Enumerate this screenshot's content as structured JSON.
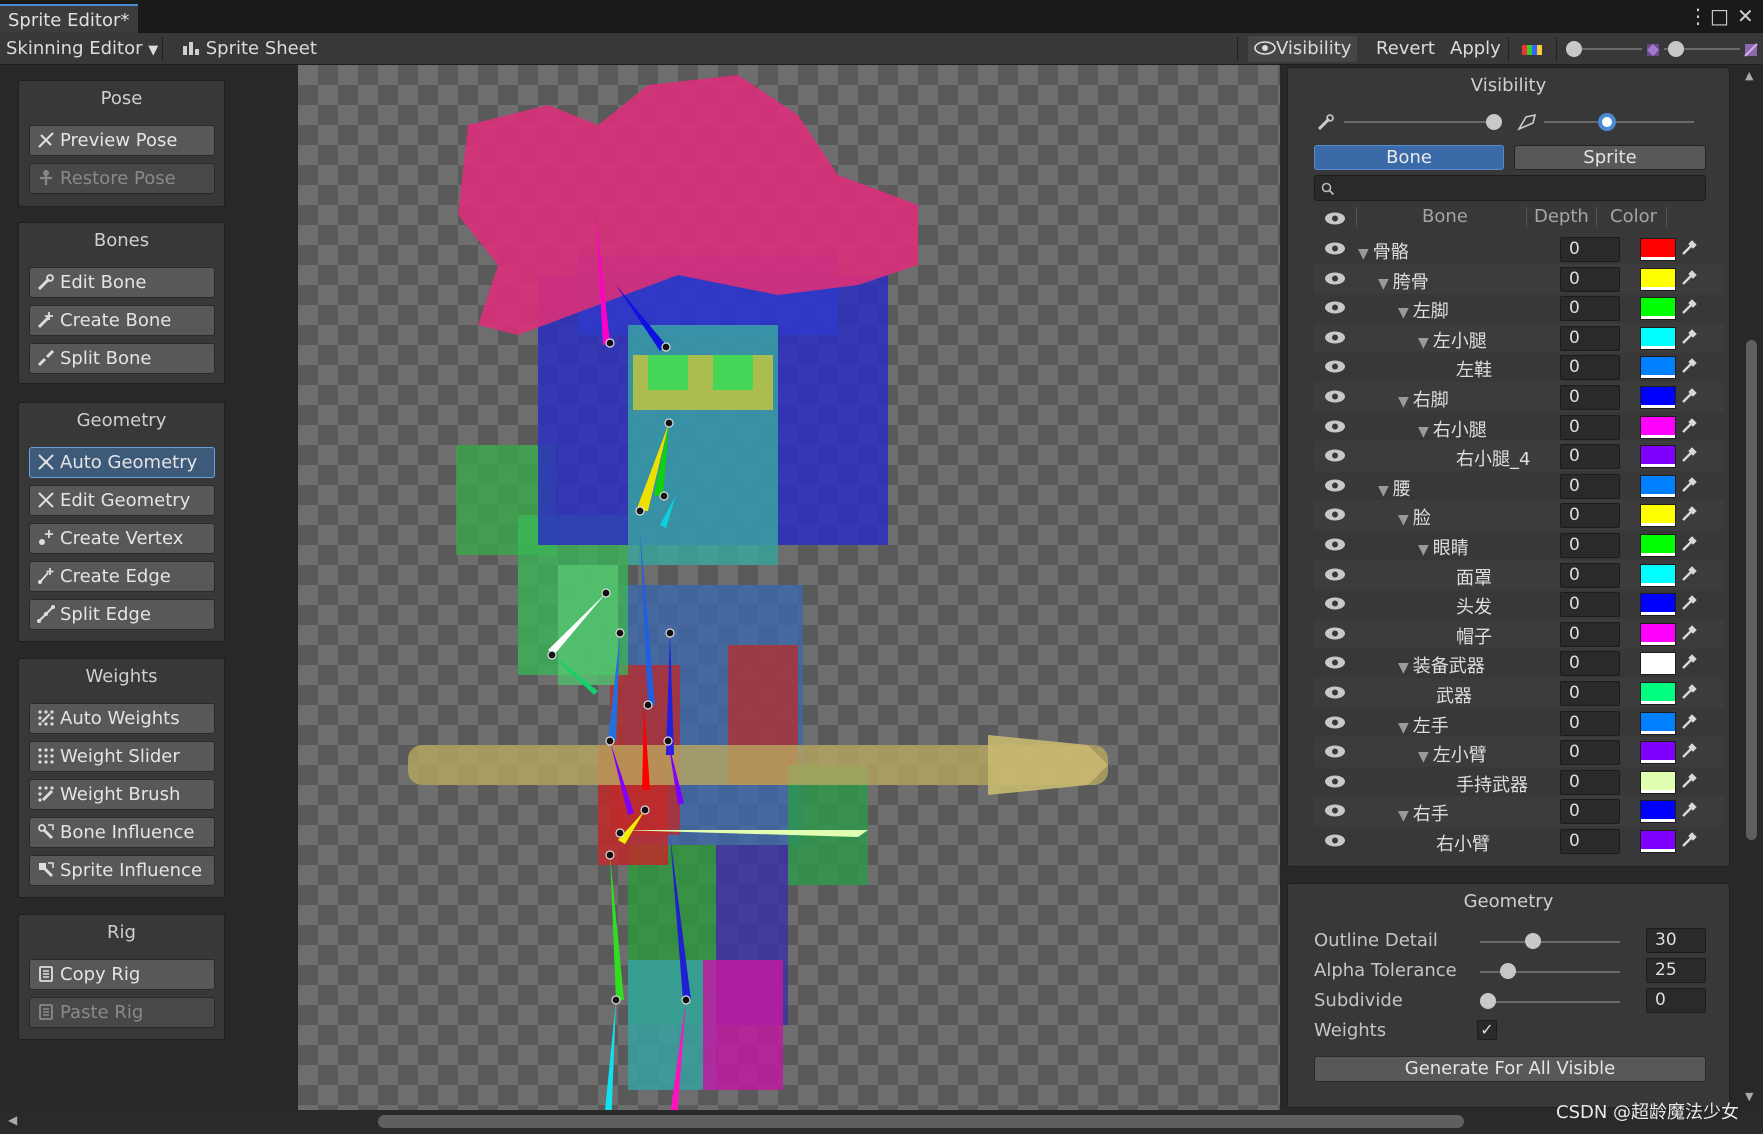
{
  "window": {
    "title": "Sprite Editor*"
  },
  "toolbar": {
    "editor_mode": "Skinning Editor",
    "sprite_sheet": "Sprite Sheet",
    "visibility": "Visibility",
    "revert": "Revert",
    "apply": "Apply"
  },
  "tools": {
    "pose": {
      "title": "Pose",
      "preview_pose": "Preview Pose",
      "restore_pose": "Restore Pose"
    },
    "bones": {
      "title": "Bones",
      "edit_bone": "Edit Bone",
      "create_bone": "Create Bone",
      "split_bone": "Split Bone"
    },
    "geometry": {
      "title": "Geometry",
      "auto_geometry": "Auto Geometry",
      "edit_geometry": "Edit Geometry",
      "create_vertex": "Create Vertex",
      "create_edge": "Create Edge",
      "split_edge": "Split Edge"
    },
    "weights": {
      "title": "Weights",
      "auto_weights": "Auto Weights",
      "weight_slider": "Weight Slider",
      "weight_brush": "Weight Brush",
      "bone_influence": "Bone Influence",
      "sprite_influence": "Sprite Influence"
    },
    "rig": {
      "title": "Rig",
      "copy_rig": "Copy Rig",
      "paste_rig": "Paste Rig"
    }
  },
  "visibility_panel": {
    "title": "Visibility",
    "bone_tab": "Bone",
    "sprite_tab": "Sprite",
    "search_placeholder": "",
    "columns": {
      "bone": "Bone",
      "depth": "Depth",
      "color": "Color"
    },
    "bone_opacity": 1.0,
    "sprite_opacity": 0.42,
    "bones": [
      {
        "name": "骨骼",
        "indent": 0,
        "arrow": true,
        "depth": "0",
        "color": "#ff0000"
      },
      {
        "name": "胯骨",
        "indent": 1,
        "arrow": true,
        "depth": "0",
        "color": "#ffff00"
      },
      {
        "name": "左脚",
        "indent": 2,
        "arrow": true,
        "depth": "0",
        "color": "#00ff00"
      },
      {
        "name": "左小腿",
        "indent": 3,
        "arrow": true,
        "depth": "0",
        "color": "#00ffff"
      },
      {
        "name": "左鞋",
        "indent": 4,
        "arrow": false,
        "depth": "0",
        "color": "#0080ff"
      },
      {
        "name": "右脚",
        "indent": 2,
        "arrow": true,
        "depth": "0",
        "color": "#0000ff"
      },
      {
        "name": "右小腿",
        "indent": 3,
        "arrow": true,
        "depth": "0",
        "color": "#ff00ff"
      },
      {
        "name": "右小腿_4",
        "indent": 4,
        "arrow": false,
        "depth": "0",
        "color": "#8000ff"
      },
      {
        "name": "腰",
        "indent": 1,
        "arrow": true,
        "depth": "0",
        "color": "#0080ff"
      },
      {
        "name": "脸",
        "indent": 2,
        "arrow": true,
        "depth": "0",
        "color": "#ffff00"
      },
      {
        "name": "眼睛",
        "indent": 3,
        "arrow": true,
        "depth": "0",
        "color": "#00ff00"
      },
      {
        "name": "面罩",
        "indent": 4,
        "arrow": false,
        "depth": "0",
        "color": "#00ffff"
      },
      {
        "name": "头发",
        "indent": 4,
        "arrow": false,
        "depth": "0",
        "color": "#0000ff"
      },
      {
        "name": "帽子",
        "indent": 4,
        "arrow": false,
        "depth": "0",
        "color": "#ff00ff"
      },
      {
        "name": "装备武器",
        "indent": 2,
        "arrow": true,
        "depth": "0",
        "color": "#ffffff"
      },
      {
        "name": "武器",
        "indent": 3,
        "arrow": false,
        "depth": "0",
        "color": "#00ff80"
      },
      {
        "name": "左手",
        "indent": 2,
        "arrow": true,
        "depth": "0",
        "color": "#0080ff"
      },
      {
        "name": "左小臂",
        "indent": 3,
        "arrow": true,
        "depth": "0",
        "color": "#8000ff"
      },
      {
        "name": "手持武器",
        "indent": 4,
        "arrow": false,
        "depth": "0",
        "color": "#e0ffb0"
      },
      {
        "name": "右手",
        "indent": 2,
        "arrow": true,
        "depth": "0",
        "color": "#0000ff"
      },
      {
        "name": "右小臂",
        "indent": 3,
        "arrow": false,
        "depth": "0",
        "color": "#8000ff"
      }
    ]
  },
  "geometry_panel": {
    "title": "Geometry",
    "outline_detail_label": "Outline Detail",
    "outline_detail": "30",
    "outline_detail_fraction": 0.32,
    "alpha_tolerance_label": "Alpha Tolerance",
    "alpha_tolerance": "25",
    "alpha_tolerance_fraction": 0.14,
    "subdivide_label": "Subdivide",
    "subdivide": "0",
    "subdivide_fraction": 0.0,
    "weights_label": "Weights",
    "weights_checked": true,
    "generate_button": "Generate For All Visible"
  },
  "watermark": "CSDN @超龄魔法少女",
  "colors": {
    "accent": "#4a8ad4",
    "active_tool": "#3d5a7a"
  }
}
